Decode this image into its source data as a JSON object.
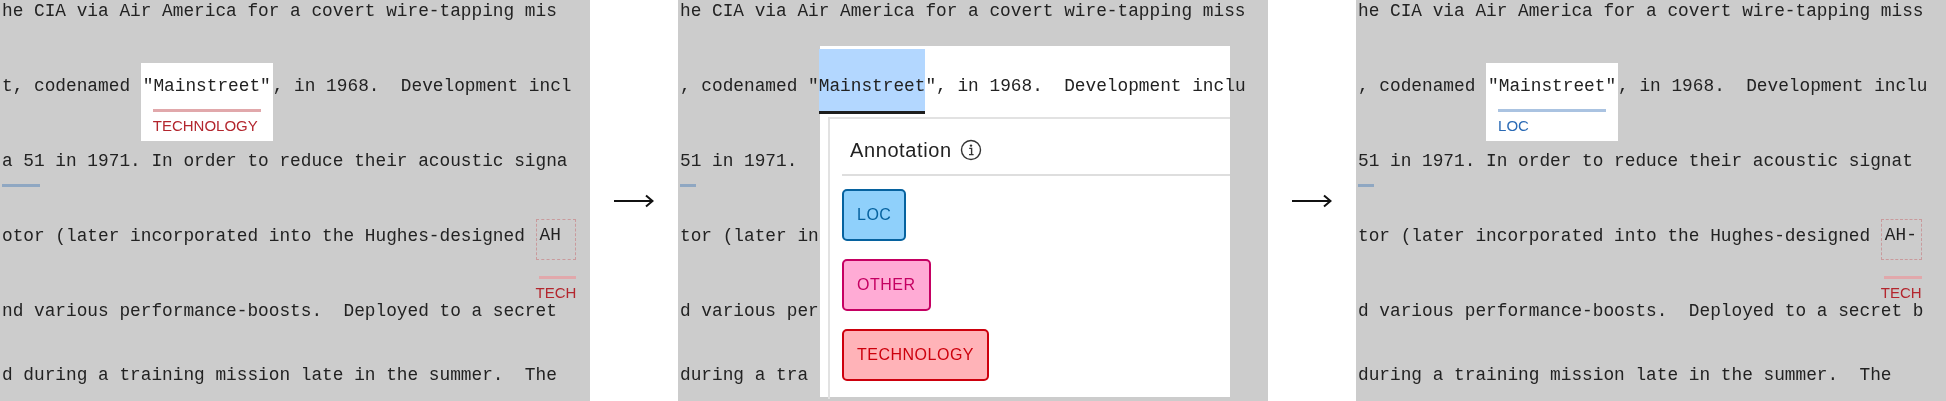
{
  "panels": [
    {
      "lines": [
        {
          "segments": [
            {
              "kind": "text",
              "text": "he CIA via Air America for a covert wire-tapping mis"
            }
          ]
        },
        {
          "segments": [
            {
              "kind": "text",
              "text": "t, codenamed "
            },
            {
              "kind": "entity",
              "text": "\"Mainstreet\"",
              "label": "TECHNOLOGY",
              "color": "#b3262e"
            },
            {
              "kind": "text",
              "text": ", in 1968.  Development incl"
            }
          ]
        },
        {
          "segments": [
            {
              "kind": "underlined",
              "text": "a 51",
              "color": "#8fa7c2"
            },
            {
              "kind": "text",
              "text": " in 1971. In order to reduce their acoustic signa"
            }
          ]
        },
        {
          "segments": [
            {
              "kind": "text",
              "text": "otor (later incorporated into the Hughes-designed "
            },
            {
              "kind": "pending",
              "text": "AH",
              "label": "TECH",
              "color": "#b3262e"
            }
          ]
        },
        {
          "segments": [
            {
              "kind": "text",
              "text": "nd various performance-boosts.  Deployed to a secret"
            }
          ]
        },
        {
          "segments": [
            {
              "kind": "text",
              "text": "d during a training mission late in the summer.  The"
            }
          ]
        }
      ]
    },
    {
      "lines": [
        {
          "segments": [
            {
              "kind": "text",
              "text": "he CIA via Air America for a covert wire-tapping miss"
            }
          ]
        },
        {
          "segments": [
            {
              "kind": "text",
              "text": ", codenamed \""
            },
            {
              "kind": "selection",
              "text": "Mainstreet"
            },
            {
              "kind": "text",
              "text": "\", in 1968.  Development inclu"
            }
          ]
        },
        {
          "segments": [
            {
              "kind": "underlined",
              "text": "51",
              "color": "#8fa7c2"
            },
            {
              "kind": "text",
              "text": " in 1971."
            }
          ]
        },
        {
          "segments": [
            {
              "kind": "text",
              "text": "tor (later in"
            }
          ]
        },
        {
          "segments": [
            {
              "kind": "text",
              "text": "d various per"
            }
          ]
        },
        {
          "segments": [
            {
              "kind": "text",
              "text": "during a tra"
            }
          ]
        }
      ],
      "popup": {
        "title": "Annotation",
        "options": [
          {
            "label": "LOC",
            "color": "#8fd0fb"
          },
          {
            "label": "OTHER",
            "color": "#ffabd5"
          },
          {
            "label": "TECHNOLOGY",
            "color": "#ffb3b8"
          }
        ]
      }
    },
    {
      "lines": [
        {
          "segments": [
            {
              "kind": "text",
              "text": "he CIA via Air America for a covert wire-tapping miss"
            }
          ]
        },
        {
          "segments": [
            {
              "kind": "text",
              "text": ", codenamed "
            },
            {
              "kind": "entity",
              "text": "\"Mainstreet\"",
              "label": "LOC",
              "color": "#2a6ab5"
            },
            {
              "kind": "text",
              "text": ", in 1968.  Development inclu"
            }
          ]
        },
        {
          "segments": [
            {
              "kind": "underlined",
              "text": "51",
              "color": "#8fa7c2"
            },
            {
              "kind": "text",
              "text": " in 1971. In order to reduce their acoustic signat"
            }
          ]
        },
        {
          "segments": [
            {
              "kind": "text",
              "text": "tor (later incorporated into the Hughes-designed "
            },
            {
              "kind": "pending",
              "text": "AH-",
              "label": "TECH",
              "color": "#b3262e"
            }
          ]
        },
        {
          "segments": [
            {
              "kind": "text",
              "text": "d various performance-boosts.  Deployed to a secret b"
            }
          ]
        },
        {
          "segments": [
            {
              "kind": "text",
              "text": "during a training mission late in the summer.  The"
            }
          ]
        }
      ]
    }
  ]
}
